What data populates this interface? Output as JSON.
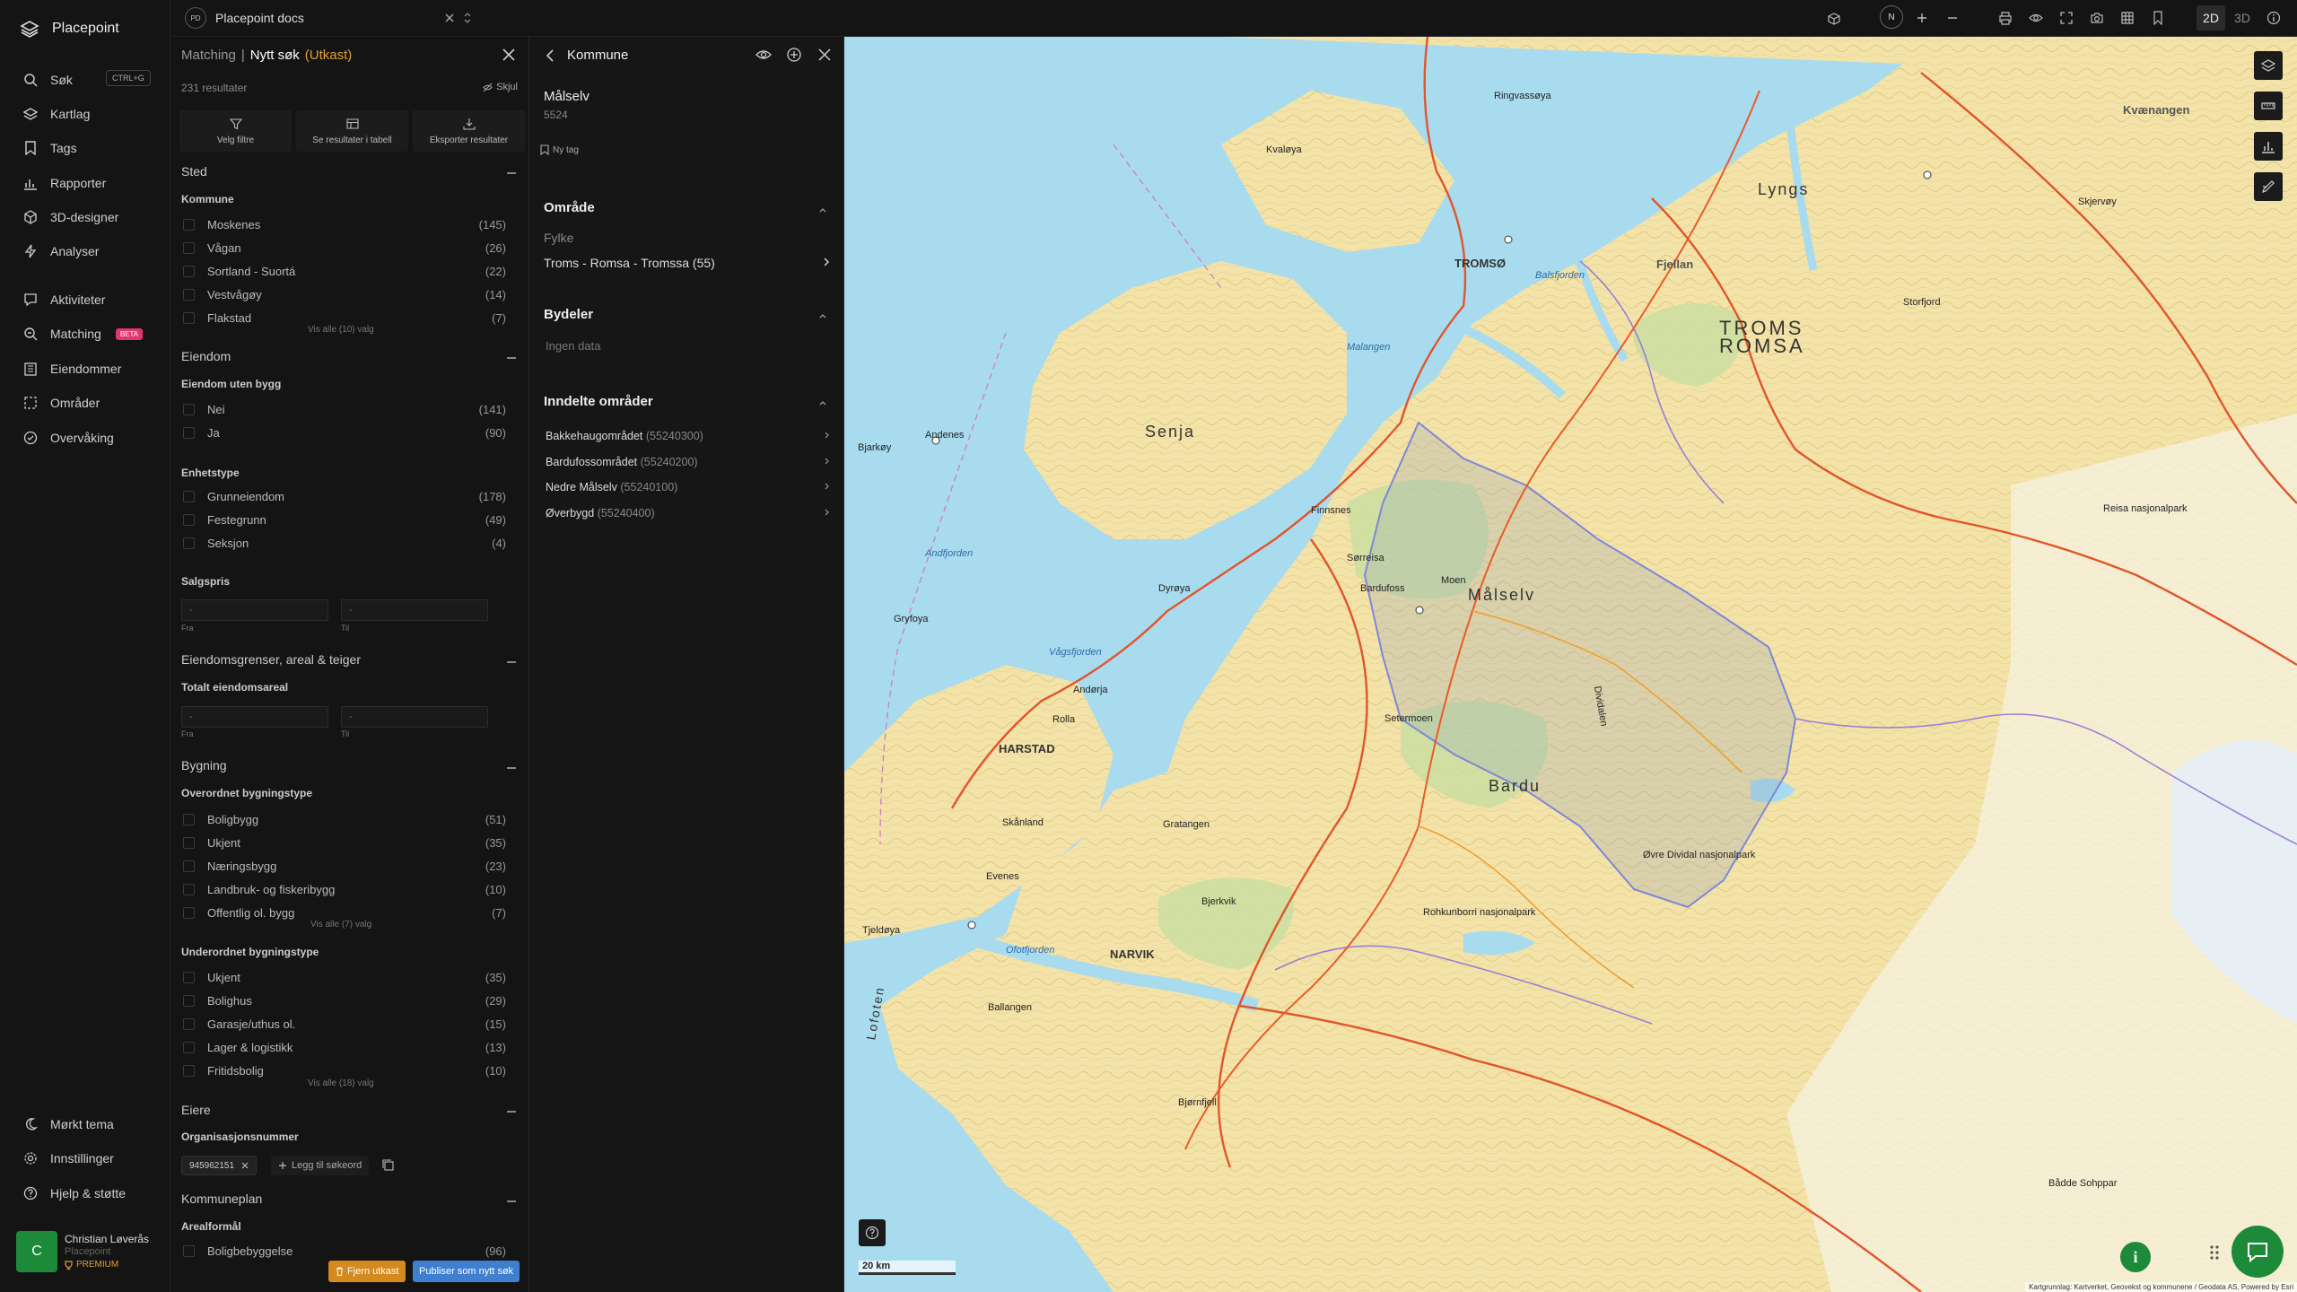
{
  "app": {
    "name": "Placepoint"
  },
  "nav": {
    "search": "Søk",
    "search_shortcut": "CTRL+G",
    "items": [
      {
        "label": "Kartlag"
      },
      {
        "label": "Tags"
      },
      {
        "label": "Rapporter"
      },
      {
        "label": "3D-designer"
      },
      {
        "label": "Analyser"
      },
      {
        "label": "Aktiviteter"
      },
      {
        "label": "Matching"
      },
      {
        "label": "Eiendommer"
      },
      {
        "label": "Områder"
      },
      {
        "label": "Overvåking"
      }
    ],
    "beta_badge": "BETA",
    "bottom": [
      {
        "label": "Mørkt tema"
      },
      {
        "label": "Innstillinger"
      },
      {
        "label": "Hjelp & støtte"
      }
    ],
    "user": {
      "initial": "C",
      "name": "Christian Løverås",
      "org": "Placepoint",
      "plan": "PREMIUM"
    }
  },
  "topbar": {
    "doc_badge": "PD",
    "doc_name": "Placepoint docs",
    "north": "N",
    "mode_2d": "2D",
    "mode_3d": "3D"
  },
  "search": {
    "breadcrumb": "Matching",
    "separator": "|",
    "title": "Nytt søk",
    "status": "(Utkast)",
    "result_count": "231 resultater",
    "hide": "Skjul",
    "actions": [
      "Velg filtre",
      "Se resultater i tabell",
      "Eksporter resultater"
    ],
    "sections": {
      "sted": "Sted",
      "kommune": "Kommune",
      "kommune_rows": [
        {
          "label": "Moskenes",
          "count": "(145)"
        },
        {
          "label": "Vågan",
          "count": "(26)"
        },
        {
          "label": "Sortland - Suortá",
          "count": "(22)"
        },
        {
          "label": "Vestvågøy",
          "count": "(14)"
        },
        {
          "label": "Flakstad",
          "count": "(7)"
        }
      ],
      "kommune_more": "Vis alle (10) valg",
      "eiendom": "Eiendom",
      "uten_bygg": "Eiendom uten bygg",
      "uten_bygg_rows": [
        {
          "label": "Nei",
          "count": "(141)"
        },
        {
          "label": "Ja",
          "count": "(90)"
        }
      ],
      "enhetstype": "Enhetstype",
      "enhetstype_rows": [
        {
          "label": "Grunneiendom",
          "count": "(178)"
        },
        {
          "label": "Festegrunn",
          "count": "(49)"
        },
        {
          "label": "Seksjon",
          "count": "(4)"
        }
      ],
      "salgspris": "Salgspris",
      "from": "Fra",
      "to": "Til",
      "input_placeholder": "-",
      "grenser": "Eiendomsgrenser, areal & teiger",
      "totalt_areal": "Totalt eiendomsareal",
      "bygning": "Bygning",
      "overordnet": "Overordnet bygningstype",
      "overordnet_rows": [
        {
          "label": "Boligbygg",
          "count": "(51)"
        },
        {
          "label": "Ukjent",
          "count": "(35)"
        },
        {
          "label": "Næringsbygg",
          "count": "(23)"
        },
        {
          "label": "Landbruk- og fiskeribygg",
          "count": "(10)"
        },
        {
          "label": "Offentlig ol. bygg",
          "count": "(7)"
        }
      ],
      "overordnet_more": "Vis alle (7) valg",
      "underordnet": "Underordnet bygningstype",
      "underordnet_rows": [
        {
          "label": "Ukjent",
          "count": "(35)"
        },
        {
          "label": "Bolighus",
          "count": "(29)"
        },
        {
          "label": "Garasje/uthus ol.",
          "count": "(15)"
        },
        {
          "label": "Lager & logistikk",
          "count": "(13)"
        },
        {
          "label": "Fritidsbolig",
          "count": "(10)"
        }
      ],
      "underordnet_more": "Vis alle (18) valg",
      "eiere": "Eiere",
      "orgnr": "Organisasjonsnummer",
      "orgnr_chip": "945962151",
      "add_keyword": "Legg til søkeord",
      "kommuneplan": "Kommuneplan",
      "arealformal": "Arealformål",
      "arealformal_row": {
        "label": "Boligbebyggelse",
        "count": "(96)"
      }
    },
    "remove_draft": "Fjern utkast",
    "publish": "Publiser som nytt søk"
  },
  "kommune": {
    "title": "Kommune",
    "name": "Målselv",
    "code": "5524",
    "new_tag": "Ny tag",
    "omrade": "Område",
    "fylke_label": "Fylke",
    "fylke_value": "Troms - Romsa - Tromssa (55)",
    "bydeler": "Bydeler",
    "no_data": "Ingen data",
    "inndelte": "Inndelte områder",
    "areas": [
      {
        "name": "Bakkehaugområdet",
        "code": "(55240300)"
      },
      {
        "name": "Bardufossområdet",
        "code": "(55240200)"
      },
      {
        "name": "Nedre Målselv",
        "code": "(55240100)"
      },
      {
        "name": "Øverbygd",
        "code": "(55240400)"
      }
    ]
  },
  "map": {
    "labels": {
      "troms": "TROMS",
      "romsa": "ROMSA",
      "tromso": "TROMSØ",
      "senja": "Senja",
      "malselv": "Målselv",
      "bardu": "Bardu",
      "harstad": "HARSTAD",
      "narvik": "NARVIK",
      "finnsnes": "Finnsnes",
      "lyngs": "Lyngs",
      "andorja": "Andørja",
      "rolla": "Rolla",
      "ofotfjorden": "Ofotfjorden",
      "vagsfjorden": "Vågsfjorden",
      "malangen": "Malangen",
      "balsfjorden": "Balsfjorden",
      "andfjorden": "Andfjorden",
      "kvaenangen": "Kvænangen",
      "bjerkvik": "Bjerkvik",
      "setermoen": "Setermoen",
      "bardufoss": "Bardufoss",
      "moen": "Moen",
      "sorreisa": "Sørreisa",
      "dyroya": "Dyrøya",
      "gryfoya": "Gryfoya",
      "andenes": "Andenes",
      "bjarkoy": "Bjarkøy",
      "ringvassoya": "Ringvassøya",
      "reisa": "Reisa nasjonalpark",
      "dividalen": "Dividalen",
      "ovre_dividal": "Øvre Dividal nasjonalpark",
      "rohkunborri": "Rohkunborri nasjonalpark",
      "storfjord": "Storfjord",
      "fjellan": "Fjellan",
      "skjervoy": "Skjervøy",
      "kvaloya": "Kvaløya",
      "gratangen": "Gratangen",
      "evenes": "Evenes",
      "ballangen": "Ballangen",
      "skanland": "Skånland",
      "tjeldoya": "Tjeldøya",
      "lofoten": "Lofoten",
      "bjornfjell": "Bjørnfjell",
      "badde": "Bådde Sohppar"
    },
    "scale": "20 km",
    "attribution": "Kartgrunnlag: Kartverket, Geovekst og kommunene / Geodata AS, Powered by Esri"
  }
}
